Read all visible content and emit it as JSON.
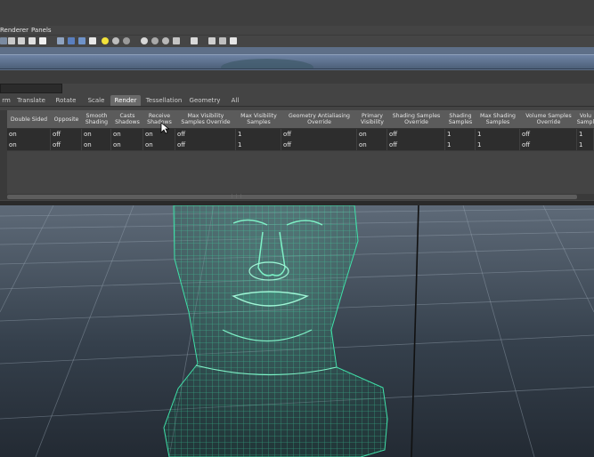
{
  "menubar": {
    "items": [
      "Renderer",
      "Panels"
    ]
  },
  "tabs": [
    {
      "label": "rm",
      "active": false
    },
    {
      "label": "Translate",
      "active": false
    },
    {
      "label": "Rotate",
      "active": false
    },
    {
      "label": "Scale",
      "active": false
    },
    {
      "label": "Render",
      "active": true
    },
    {
      "label": "Tessellation",
      "active": false
    },
    {
      "label": "Geometry",
      "active": false
    },
    {
      "label": "All",
      "active": false
    }
  ],
  "table": {
    "columns": [
      "Double Sided",
      "Opposite",
      "Smooth\nShading",
      "Casts\nShadows",
      "Receive\nShadows",
      "Max Visibility\nSamples Override",
      "Max Visibility\nSamples",
      "Geometry Antialiasing\nOverride",
      "Primary\nVisibility",
      "Shading Samples\nOverride",
      "Shading\nSamples",
      "Max Shading\nSamples",
      "Volume Samples\nOverride",
      "Volu\nSampl"
    ],
    "rows": [
      [
        "on",
        "off",
        "on",
        "on",
        "on",
        "off",
        "1",
        "off",
        "on",
        "off",
        "1",
        "1",
        "off",
        "1"
      ],
      [
        "on",
        "off",
        "on",
        "on",
        "on",
        "off",
        "1",
        "off",
        "on",
        "off",
        "1",
        "1",
        "off",
        "1"
      ]
    ]
  },
  "colors": {
    "wireframe": "#3fe0a8",
    "viewport_top": "#5e6a78",
    "viewport_bottom": "#232a33",
    "active_tab": "#6a6a6a"
  },
  "icons": [
    "cursor-arrow-icon",
    "toolbar-icons",
    "resize-grip-icon"
  ]
}
